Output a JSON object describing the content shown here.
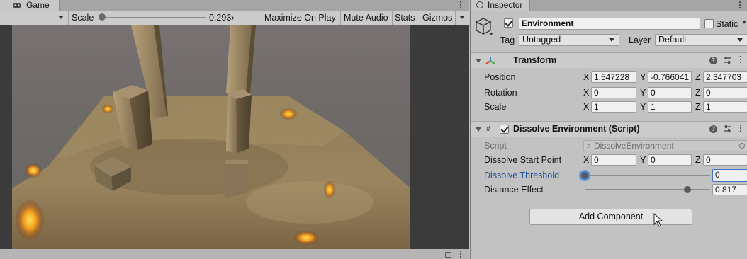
{
  "game": {
    "tab_label": "Game",
    "scale_label": "Scale",
    "scale_value": "0.293›",
    "maximize_label": "Maximize On Play",
    "mute_label": "Mute Audio",
    "stats_label": "Stats",
    "gizmos_label": "Gizmos",
    "scale_slider_fraction": 0.0
  },
  "inspector": {
    "tab_label": "Inspector",
    "object": {
      "name": "Environment",
      "active": true,
      "static_label": "Static",
      "static": false,
      "tag_label": "Tag",
      "tag_value": "Untagged",
      "layer_label": "Layer",
      "layer_value": "Default"
    },
    "transform": {
      "title": "Transform",
      "position_label": "Position",
      "rotation_label": "Rotation",
      "scale_label": "Scale",
      "position": {
        "x": "1.547228",
        "y": "-0.766041",
        "z": "2.347703"
      },
      "rotation": {
        "x": "0",
        "y": "0",
        "z": "0"
      },
      "scale": {
        "x": "1",
        "y": "1",
        "z": "1"
      }
    },
    "axes": {
      "x": "X",
      "y": "Y",
      "z": "Z"
    },
    "dissolve": {
      "title": "Dissolve Environment (Script)",
      "enabled": true,
      "script_label": "Script",
      "script_value": "DissolveEnvironment",
      "start_point_label": "Dissolve Start Point",
      "start_point": {
        "x": "0",
        "y": "0",
        "z": "0"
      },
      "threshold_label": "Dissolve Threshold",
      "threshold_value": "0",
      "threshold_fraction": 0.0,
      "distance_label": "Distance Effect",
      "distance_value": "0.817",
      "distance_fraction": 0.817
    },
    "add_component_label": "Add Component"
  }
}
